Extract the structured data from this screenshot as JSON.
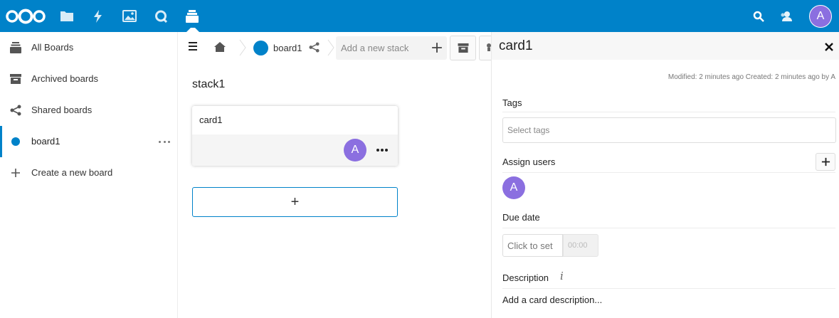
{
  "header": {
    "apps": [
      {
        "name": "logo",
        "icon": "nextcloud-logo-icon"
      },
      {
        "name": "files",
        "icon": "folder-icon"
      },
      {
        "name": "activity",
        "icon": "lightning-icon"
      },
      {
        "name": "gallery",
        "icon": "image-icon"
      },
      {
        "name": "talk",
        "icon": "chat-bubble-icon"
      },
      {
        "name": "deck",
        "icon": "deck-icon",
        "active": true
      }
    ],
    "search_icon": "search-icon",
    "contacts_icon": "contacts-icon",
    "user_initial": "A",
    "brand_color": "#0082c9"
  },
  "nav": {
    "items": [
      {
        "label": "All Boards",
        "icon": "stack-icon"
      },
      {
        "label": "Archived boards",
        "icon": "archive-icon"
      },
      {
        "label": "Shared boards",
        "icon": "share-icon"
      },
      {
        "label": "board1",
        "icon": "board-dot",
        "color": "#0082c9",
        "active": true
      },
      {
        "label": "Create a new board",
        "icon": "plus-icon"
      }
    ]
  },
  "board": {
    "breadcrumb_board": "board1",
    "new_stack_placeholder": "Add a new stack",
    "stack": {
      "title": "stack1",
      "cards": [
        {
          "title": "card1",
          "assignee_initial": "A"
        }
      ],
      "add_card_label": "+"
    }
  },
  "sidebar": {
    "title": "card1",
    "meta": "Modified: 2 minutes ago Created: 2 minutes ago by A",
    "tags_label": "Tags",
    "tags_placeholder": "Select tags",
    "assign_label": "Assign users",
    "assigned_initial": "A",
    "due_label": "Due date",
    "due_placeholder": "Click to set",
    "time_placeholder": "00:00",
    "description_label": "Description",
    "description_info": "i",
    "description_placeholder": "Add a card description..."
  },
  "colors": {
    "avatar": "#8b6fe0",
    "accent": "#0082c9"
  }
}
